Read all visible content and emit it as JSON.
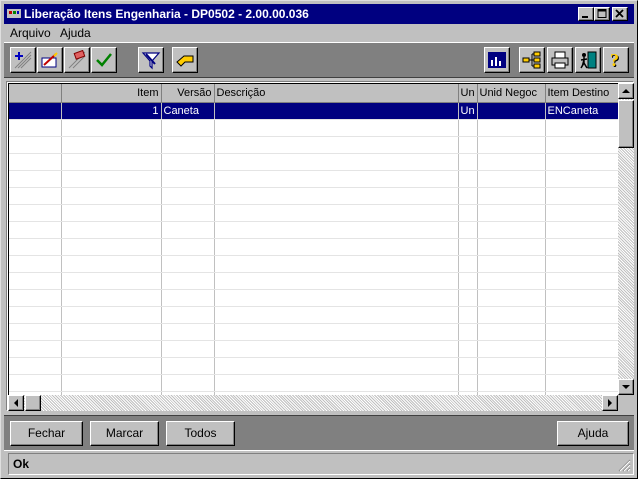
{
  "window": {
    "title": "Liberação Itens Engenharia - DP0502 - 2.00.00.036"
  },
  "menu": [
    {
      "label": "Arquivo"
    },
    {
      "label": "Ajuda"
    }
  ],
  "toolbar": {
    "left": [
      "add-icon",
      "edit-icon",
      "eraser-icon",
      "check-icon",
      "filter-icon",
      "goto-icon"
    ],
    "right": [
      "chart-icon",
      "tree-icon",
      "print-icon",
      "exit-icon",
      "help-icon"
    ]
  },
  "grid": {
    "columns": [
      "",
      "Item",
      "Versão",
      "Descrição",
      "Un",
      "Unid Negoc",
      "Item Destino"
    ],
    "rows": [
      {
        "item": "1",
        "versao": "Caneta",
        "descricao": "",
        "un": "Un",
        "unid_negoc": "",
        "item_destino": "ENCaneta"
      }
    ]
  },
  "buttons": {
    "fechar": "Fechar",
    "marcar": "Marcar",
    "todos": "Todos",
    "ajuda": "Ajuda"
  },
  "status": {
    "text": "Ok"
  },
  "colors": {
    "title_bar": "#000080",
    "selection": "#000080",
    "face": "#c0c0c0"
  }
}
